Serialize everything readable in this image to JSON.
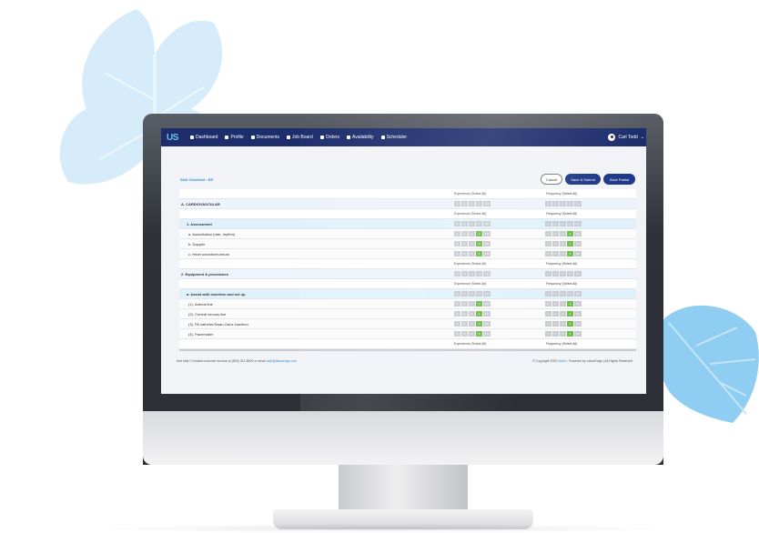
{
  "nav": {
    "logo": "US",
    "items": [
      {
        "label": "Dashboard",
        "icon": "grid-icon"
      },
      {
        "label": "Profile",
        "icon": "profile-icon"
      },
      {
        "label": "Documents",
        "icon": "document-icon"
      },
      {
        "label": "Job Board",
        "icon": "briefcase-icon"
      },
      {
        "label": "Orders",
        "icon": "orders-icon"
      },
      {
        "label": "Availability",
        "icon": "calendar-icon"
      },
      {
        "label": "Scheduler",
        "icon": "scheduler-icon"
      }
    ],
    "user": "Carl Todd"
  },
  "page": {
    "title": "Skill Checklist : ER",
    "cancel_label": "Cancel",
    "save_submit_label": "Save & Submit",
    "save_partial_label": "Save Partial"
  },
  "columns": {
    "experience": "Experience (Select All)",
    "frequency": "Frequency (Select All)"
  },
  "scale_labels": [
    "1",
    "2",
    "3",
    "4",
    "NA"
  ],
  "rows": [
    {
      "type": "hdr",
      "label": ""
    },
    {
      "type": "section",
      "label": "A. CARDIOVASCULAR",
      "exp": null,
      "freq": null
    },
    {
      "type": "hdr",
      "label": ""
    },
    {
      "type": "sub",
      "label": "1. Assessment",
      "exp": null,
      "freq": null
    },
    {
      "type": "item",
      "label": "a. Auscultation (rate, rhythm)",
      "exp": 4,
      "freq": 4
    },
    {
      "type": "item",
      "label": "b. Doppler",
      "exp": 4,
      "freq": 4
    },
    {
      "type": "item",
      "label": "c. Heart sounds/murmurs",
      "exp": 4,
      "freq": 4
    },
    {
      "type": "hdr",
      "label": ""
    },
    {
      "type": "section",
      "label": "2. Equipment & procedures",
      "exp": null,
      "freq": null
    },
    {
      "type": "hdr",
      "label": ""
    },
    {
      "type": "sub",
      "label": "a. Assist with insertion and set up",
      "exp": null,
      "freq": null
    },
    {
      "type": "item",
      "label": "(1). Arterial line",
      "exp": 4,
      "freq": 4
    },
    {
      "type": "item",
      "label": "(2). Central venous line",
      "exp": 4,
      "freq": 4
    },
    {
      "type": "item",
      "label": "(3). PA catheter/Swan-Ganz insertion",
      "exp": 4,
      "freq": 4
    },
    {
      "type": "item",
      "label": "(4). Pacemaker",
      "exp": 4,
      "freq": 4
    },
    {
      "type": "hdr",
      "label": ""
    }
  ],
  "footer": {
    "help_text": "eed help? Contact customer service at (800) 311-8000 or email",
    "help_email": "help@laboredge.com",
    "copyright": "© Copyright 2020",
    "brand": "NetCo",
    "powered": ". Powered by LaborEdge | All Rights Reserved"
  },
  "colors": {
    "navbar": "#1e2e6d",
    "button": "#1f3a8a",
    "selected": "#6cc04a",
    "accent": "#2f8fd0"
  }
}
